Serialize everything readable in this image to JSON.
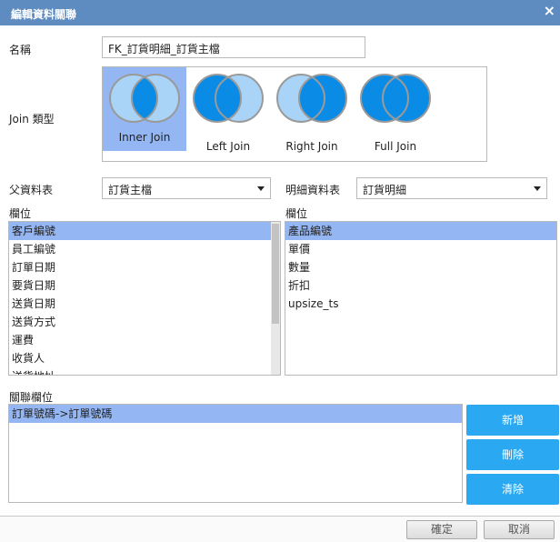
{
  "window": {
    "title": "編輯資料關聯",
    "close_icon": "×"
  },
  "name_field": {
    "label": "名稱",
    "value": "FK_訂貨明細_訂貨主檔"
  },
  "join_type": {
    "label": "Join 類型",
    "selected": "Inner Join",
    "options": [
      {
        "label": "Inner Join"
      },
      {
        "label": "Left Join"
      },
      {
        "label": "Right Join"
      },
      {
        "label": "Full Join"
      }
    ],
    "colors": {
      "filled": "#0a8ce6",
      "light": "#a9d4f7",
      "stroke": "#9a9a9a",
      "selected_bg": "#94b6f3"
    }
  },
  "parent_table": {
    "label": "父資料表",
    "value": "訂貨主檔"
  },
  "detail_table": {
    "label": "明細資料表",
    "value": "訂貨明細"
  },
  "parent_fields": {
    "label": "欄位",
    "items": [
      "客戶編號",
      "員工編號",
      "訂單日期",
      "要貨日期",
      "送貨日期",
      "送貨方式",
      "運費",
      "收貨人",
      "送貨地址"
    ],
    "selected_index": 0
  },
  "detail_fields": {
    "label": "欄位",
    "items": [
      "產品編號",
      "單價",
      "數量",
      "折扣",
      "upsize_ts"
    ],
    "selected_index": 0
  },
  "relation_fields": {
    "label": "關聯欄位",
    "items": [
      "訂單號碼->訂單號碼"
    ],
    "selected_index": 0
  },
  "actions": {
    "add": "新增",
    "delete": "刪除",
    "clear": "清除"
  },
  "footer": {
    "ok": "確定",
    "cancel": "取消"
  }
}
